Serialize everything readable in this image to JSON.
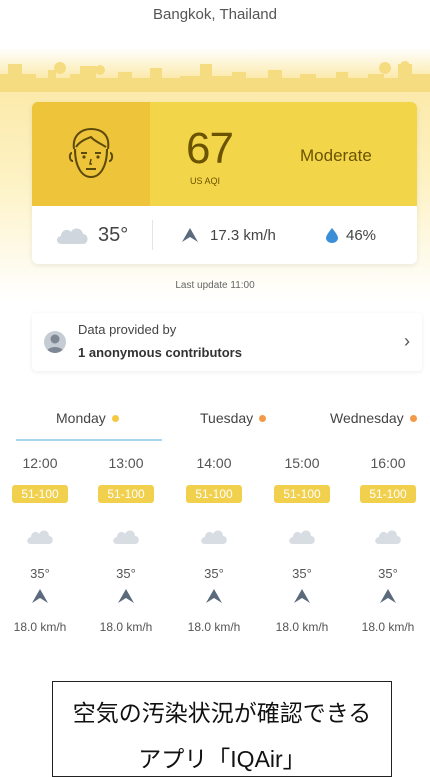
{
  "header": {
    "city": "Bangkok, Thailand"
  },
  "aqi": {
    "value": "67",
    "unit": "US AQI",
    "level": "Moderate",
    "color": "#f3d54a",
    "face_color": "#eec43a",
    "icon": "face-icon"
  },
  "weather": {
    "temperature": "35°",
    "temperature_icon": "cloud-icon",
    "wind": "17.3 km/h",
    "wind_icon": "wind-direction-arrow-icon",
    "humidity": "46%",
    "humidity_icon": "water-drop-icon"
  },
  "last_update": "Last update 11:00",
  "contributors": {
    "label": "Data provided by",
    "value": "1 anonymous contributors",
    "chevron": "›"
  },
  "forecast": {
    "days": [
      {
        "label": "Monday",
        "dot_color": "#f5c842",
        "selected": true
      },
      {
        "label": "Tuesday",
        "dot_color": "#f39a4a",
        "selected": false
      },
      {
        "label": "Wednesday",
        "dot_color": "#f39a4a",
        "selected": false
      }
    ],
    "hours": [
      {
        "time": "12:00",
        "range": "51-100",
        "temp": "35°",
        "wind": "18.0 km/h"
      },
      {
        "time": "13:00",
        "range": "51-100",
        "temp": "35°",
        "wind": "18.0 km/h"
      },
      {
        "time": "14:00",
        "range": "51-100",
        "temp": "35°",
        "wind": "18.0 km/h"
      },
      {
        "time": "15:00",
        "range": "51-100",
        "temp": "35°",
        "wind": "18.0 km/h"
      },
      {
        "time": "16:00",
        "range": "51-100",
        "temp": "35°",
        "wind": "18.0 km/h"
      }
    ]
  },
  "caption": {
    "line1": "空気の汚染状況が確認できる",
    "line2": "アプリ「IQAir」"
  }
}
